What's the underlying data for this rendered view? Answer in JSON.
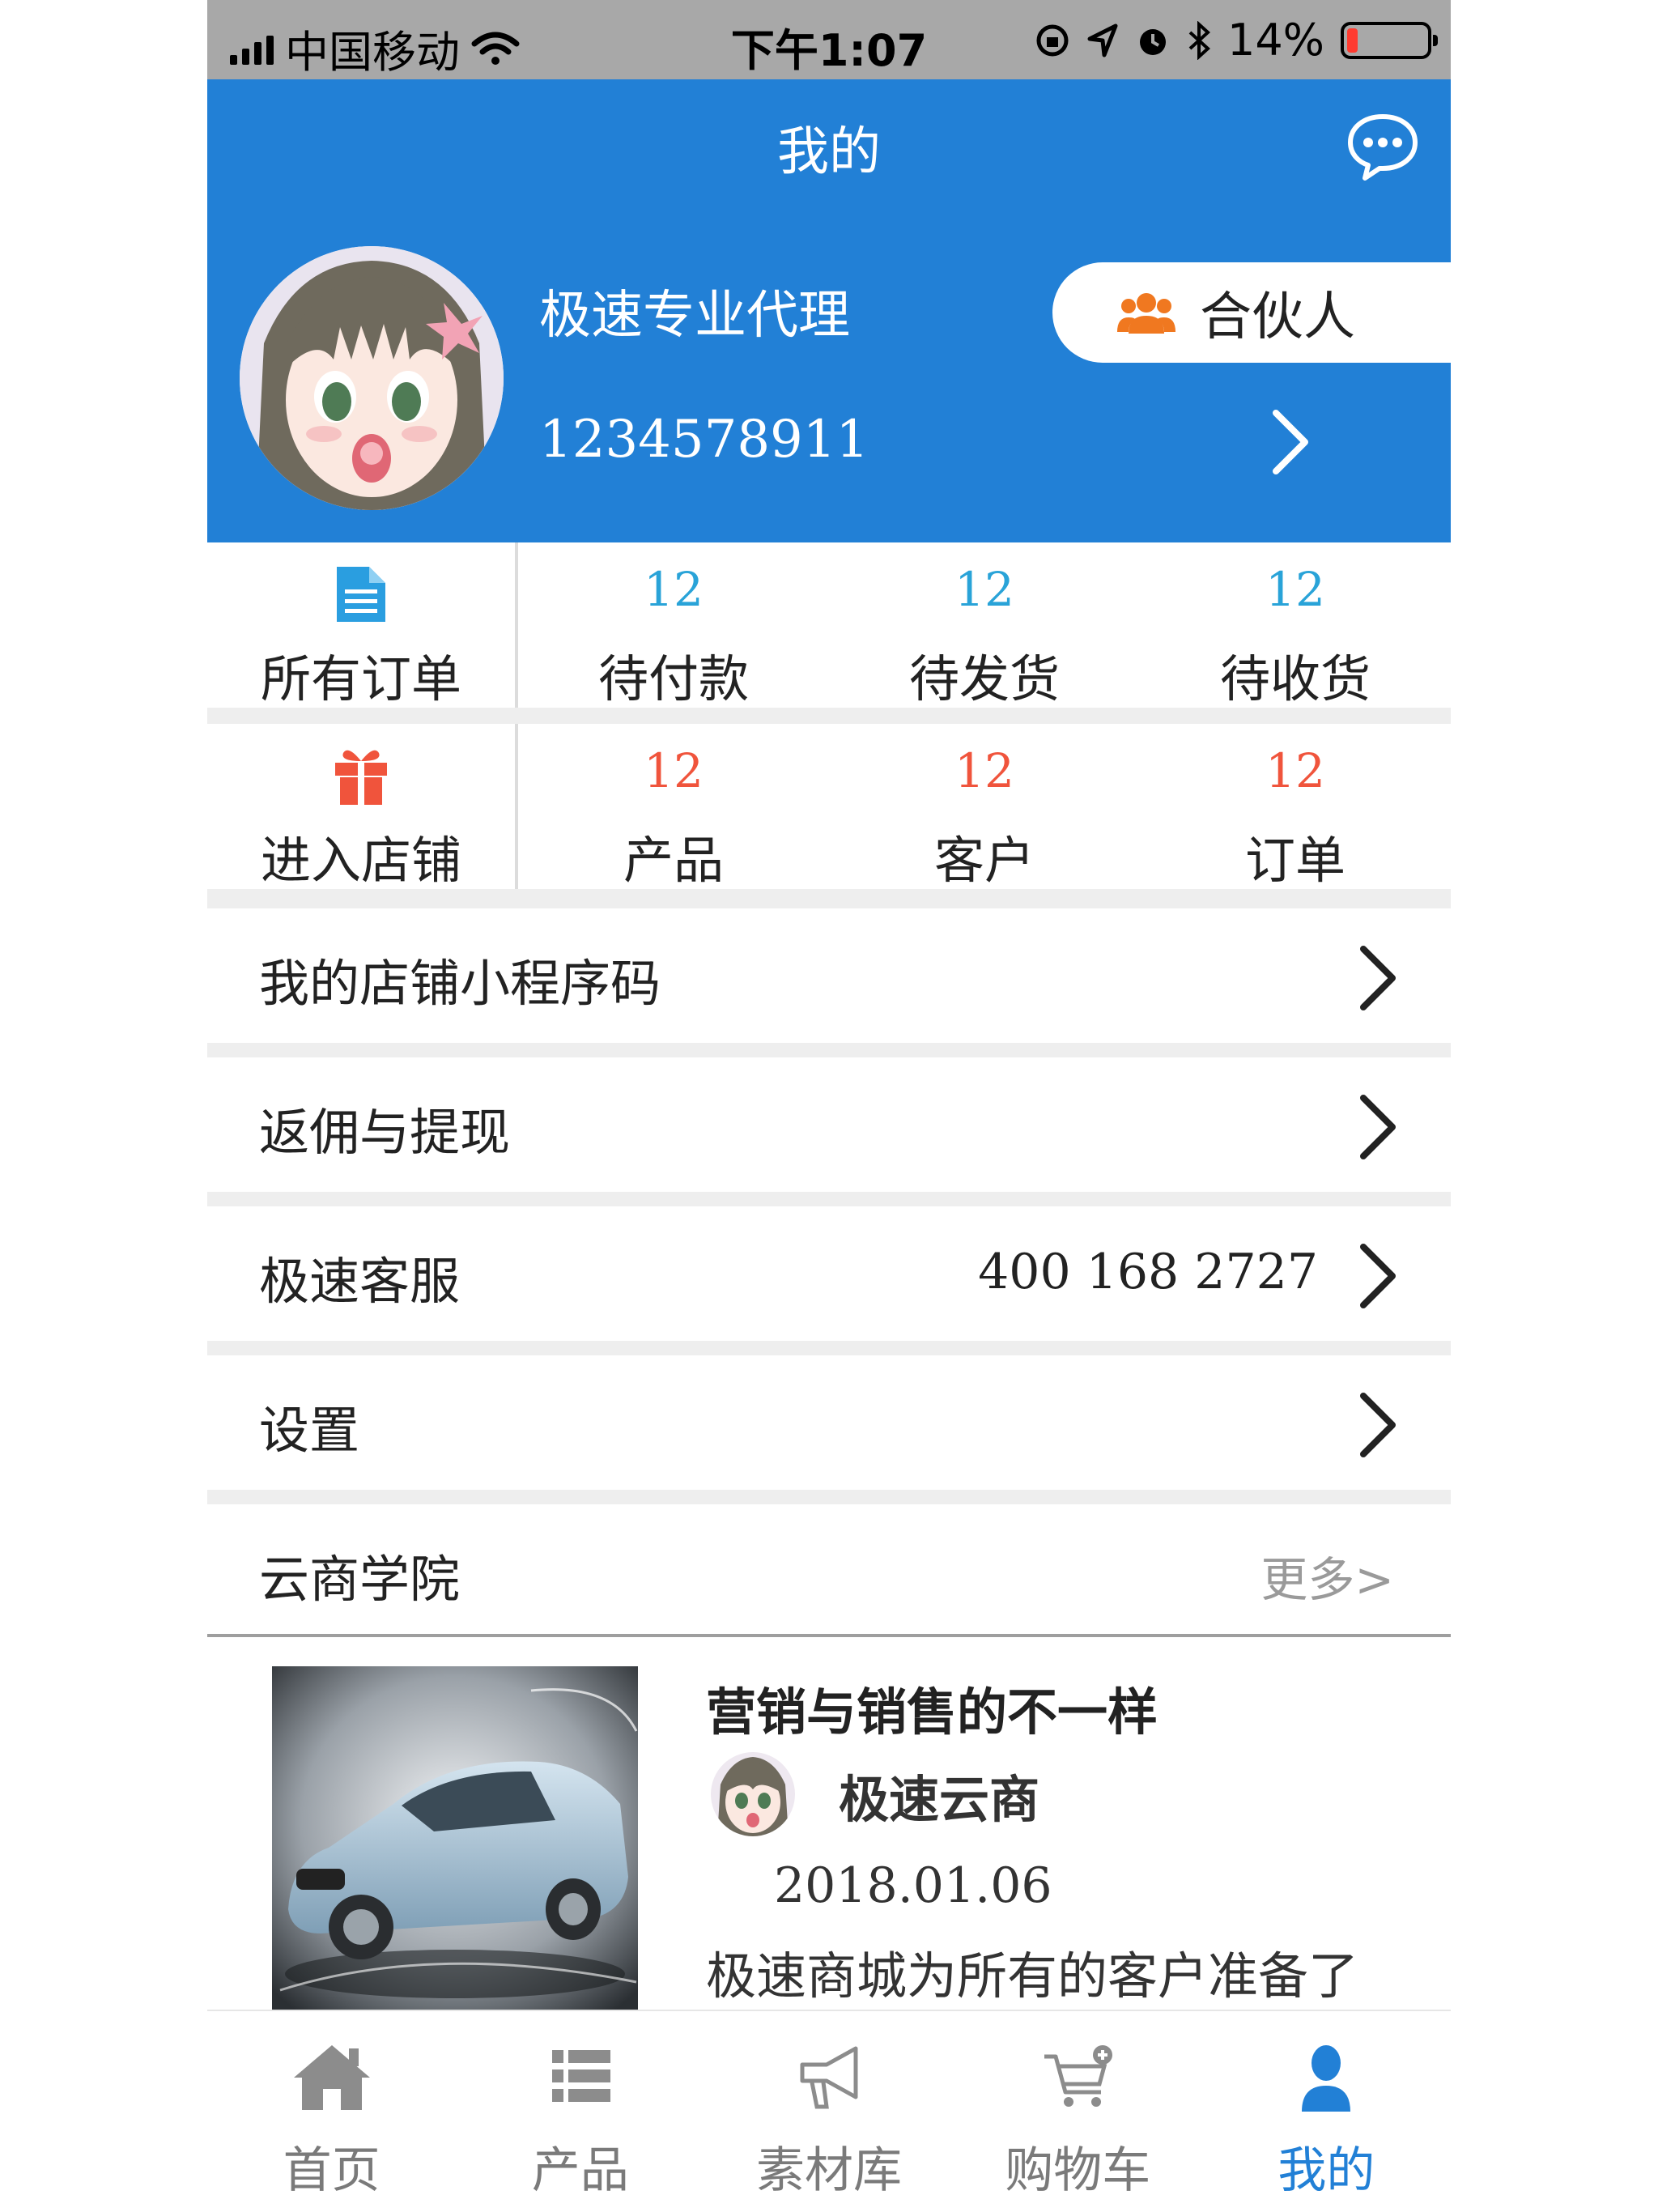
{
  "status_bar": {
    "carrier": "中国移动",
    "time": "下午1:07",
    "battery_percent": "14%",
    "battery_level": 0.14,
    "battery_color": "#ff3b30"
  },
  "header": {
    "title": "我的",
    "message_icon": "chat-bubble-icon",
    "nickname": "极速专业代理",
    "phone": "1234578911",
    "partner_label": "合伙人",
    "partner_icon": "group-icon",
    "chevron_icon": "chevron-right-icon",
    "accent_color": "#2280d6"
  },
  "orders": {
    "all_orders_label": "所有订单",
    "all_orders_icon": "document-icon",
    "items": [
      {
        "count": "12",
        "label": "待付款"
      },
      {
        "count": "12",
        "label": "待发货"
      },
      {
        "count": "12",
        "label": "待收货"
      }
    ],
    "count_color": "#29a3d8"
  },
  "store": {
    "enter_store_label": "进入店铺",
    "enter_store_icon": "gift-icon",
    "items": [
      {
        "count": "12",
        "label": "产品"
      },
      {
        "count": "12",
        "label": "客户"
      },
      {
        "count": "12",
        "label": "订单"
      }
    ],
    "count_color": "#f0543c"
  },
  "menu": {
    "mini_program_code": "我的店铺小程序码",
    "commission": "返佣与提现",
    "service": "极速客服",
    "service_phone": "400 168 2727",
    "settings": "设置"
  },
  "academy": {
    "title": "云商学院",
    "more": "更多>"
  },
  "article": {
    "title": "营销与销售的不一样",
    "author": "极速云商",
    "date": "2018.01.06",
    "excerpt": "极速商城为所有的客户准备了"
  },
  "tabbar": {
    "items": [
      {
        "label": "首页",
        "icon": "home-icon"
      },
      {
        "label": "产品",
        "icon": "list-icon"
      },
      {
        "label": "素材库",
        "icon": "megaphone-icon"
      },
      {
        "label": "购物车",
        "icon": "cart-icon"
      },
      {
        "label": "我的",
        "icon": "user-icon"
      }
    ],
    "active": "我的"
  }
}
